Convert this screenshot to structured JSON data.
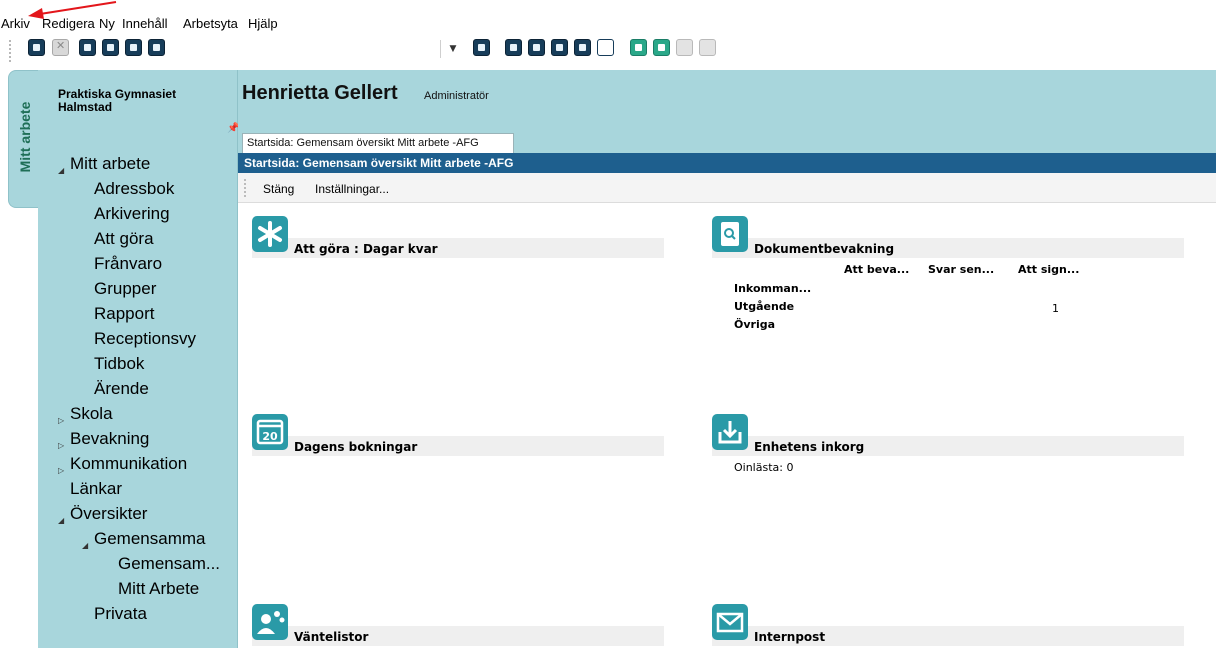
{
  "menu": [
    "Arkiv",
    "Redigera",
    "Ny",
    "Innehåll",
    "Arbetsyta",
    "Hjälp"
  ],
  "toolbar": {
    "icons": [
      "search-icon",
      "close-document-icon",
      "copy-icon",
      "paste-icon",
      "page-icon",
      "print-icon",
      "refresh-icon",
      "layout-grid-icon",
      "layout-columns-icon",
      "layout-rows-icon",
      "layout-single-icon",
      "mail-icon",
      "asterisk-icon",
      "group-icon",
      "calendar-icon"
    ],
    "dropdown_value": ""
  },
  "vertical_tab": "Mitt arbete",
  "organization": "Praktiska Gymnasiet\nHalmstad",
  "nav": [
    {
      "label": "Mitt arbete",
      "expanded": true
    },
    {
      "label": "Adressbok"
    },
    {
      "label": "Arkivering"
    },
    {
      "label": "Att göra"
    },
    {
      "label": "Frånvaro"
    },
    {
      "label": "Grupper"
    },
    {
      "label": "Rapport"
    },
    {
      "label": "Receptionsvy"
    },
    {
      "label": "Tidbok"
    },
    {
      "label": "Ärende"
    },
    {
      "label": "Skola",
      "expanded": false
    },
    {
      "label": "Bevakning",
      "expanded": false
    },
    {
      "label": "Kommunikation",
      "expanded": false
    },
    {
      "label": "Länkar"
    },
    {
      "label": "Översikter",
      "expanded": true
    },
    {
      "label": "Gemensamma",
      "expanded": true
    },
    {
      "label": "Gemensam..."
    },
    {
      "label": "Mitt Arbete"
    },
    {
      "label": "Privata"
    }
  ],
  "header": {
    "user_name": "Henrietta Gellert",
    "role": "Administratör",
    "tab": "Startsida: Gemensam översikt Mitt arbete -AFG"
  },
  "page_title": "Startsida: Gemensam översikt Mitt arbete -AFG",
  "commands": [
    "Stäng",
    "Inställningar..."
  ],
  "widgets": {
    "todo": {
      "title": "Att göra : Dagar kvar",
      "icon": "asterisk-icon"
    },
    "doc_watch": {
      "title": "Dokumentbevakning",
      "icon": "document-search-icon",
      "columns": [
        "Att beva...",
        "Svar sen...",
        "Att sign..."
      ],
      "rows": [
        {
          "label": "Inkomman...",
          "values": [
            "",
            "",
            ""
          ]
        },
        {
          "label": "Utgående",
          "values": [
            "",
            "",
            "1"
          ]
        },
        {
          "label": "Övriga",
          "values": [
            "",
            "",
            ""
          ]
        }
      ]
    },
    "bookings": {
      "title": "Dagens bokningar",
      "icon": "calendar-icon",
      "icon_text": "20"
    },
    "inbox": {
      "title": "Enhetens inkorg",
      "icon": "download-tray-icon",
      "text": "Oinlästa: 0"
    },
    "waitlist": {
      "title": "Väntelistor",
      "icon": "group-icon"
    },
    "internal_mail": {
      "title": "Internpost",
      "icon": "mail-icon"
    }
  },
  "colors": {
    "panel": "#a8d6dc",
    "titlebar": "#1e5f8e",
    "widget_icon": "#2a9aa7",
    "annotation_arrow": "#e3161b"
  }
}
